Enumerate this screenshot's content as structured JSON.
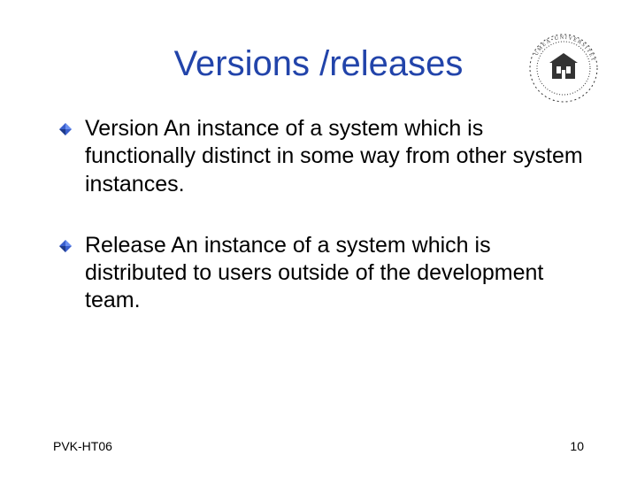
{
  "title": "Versions /releases",
  "bullets": [
    {
      "term": "Version",
      "definition": "  An instance of a system which is functionally distinct in some way from other system instances."
    },
    {
      "term": "Release",
      "definition": "  An instance of a system which is distributed to users outside of the development team."
    }
  ],
  "footer": {
    "left": "PVK-HT06",
    "right": "10"
  },
  "logo_alt": "Umeå University"
}
